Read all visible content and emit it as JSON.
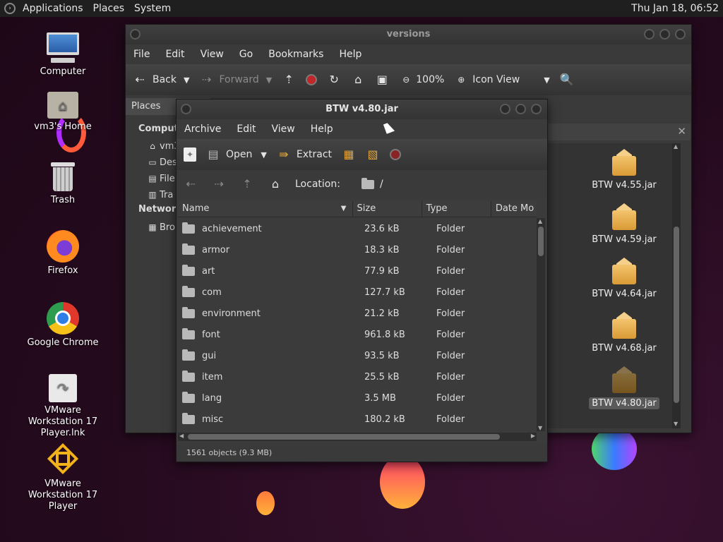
{
  "panel": {
    "menus": [
      "Applications",
      "Places",
      "System"
    ],
    "clock": "Thu Jan 18, 06:52"
  },
  "desktop_icons": [
    {
      "label": "Computer",
      "icon": "computer-icon"
    },
    {
      "label": "vm3's Home",
      "icon": "home-folder-icon"
    },
    {
      "label": "Trash",
      "icon": "trash-icon"
    },
    {
      "label": "Firefox",
      "icon": "firefox-icon"
    },
    {
      "label": "Google Chrome",
      "icon": "chrome-icon"
    },
    {
      "label": "VMware Workstation 17 Player.lnk",
      "icon": "vmware-link-icon"
    },
    {
      "label": "VMware Workstation 17 Player",
      "icon": "vmware-icon"
    }
  ],
  "browser": {
    "title": "versions",
    "menus": [
      "File",
      "Edit",
      "View",
      "Go",
      "Bookmarks",
      "Help"
    ],
    "toolbar": {
      "back": "Back",
      "forward": "Forward",
      "zoom": "100%",
      "view_mode": "Icon View"
    },
    "places_label": "Places",
    "sidebar": {
      "computer_header": "Computer",
      "items": [
        "vm3",
        "Des",
        "File",
        "Tra"
      ],
      "network_header": "Network",
      "network_items": [
        "Bro"
      ]
    },
    "files": [
      "BTW v4.55.jar",
      "BTW v4.59.jar",
      "BTW v4.64.jar",
      "BTW v4.68.jar",
      "BTW v4.80.jar"
    ],
    "selected_file": "BTW v4.80.jar"
  },
  "archive": {
    "title": "BTW v4.80.jar",
    "menus": [
      "Archive",
      "Edit",
      "View",
      "Help"
    ],
    "toolbar": {
      "open": "Open",
      "extract": "Extract"
    },
    "location_label": "Location:",
    "location_value": "/",
    "columns": [
      "Name",
      "Size",
      "Type",
      "Date Mo"
    ],
    "rows": [
      {
        "name": "achievement",
        "size": "23.6 kB",
        "type": "Folder"
      },
      {
        "name": "armor",
        "size": "18.3 kB",
        "type": "Folder"
      },
      {
        "name": "art",
        "size": "77.9 kB",
        "type": "Folder"
      },
      {
        "name": "com",
        "size": "127.7 kB",
        "type": "Folder"
      },
      {
        "name": "environment",
        "size": "21.2 kB",
        "type": "Folder"
      },
      {
        "name": "font",
        "size": "961.8 kB",
        "type": "Folder"
      },
      {
        "name": "gui",
        "size": "93.5 kB",
        "type": "Folder"
      },
      {
        "name": "item",
        "size": "25.5 kB",
        "type": "Folder"
      },
      {
        "name": "lang",
        "size": "3.5 MB",
        "type": "Folder"
      },
      {
        "name": "misc",
        "size": "180.2 kB",
        "type": "Folder"
      }
    ],
    "status": "1561 objects (9.3 MB)"
  }
}
